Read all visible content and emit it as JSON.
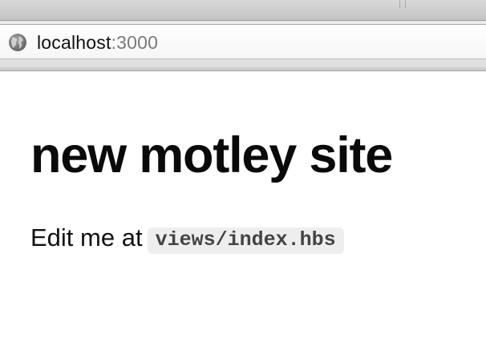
{
  "browser": {
    "url_host": "localhost",
    "url_port": ":3000",
    "address_icon": "globe-icon"
  },
  "page": {
    "title": "new motley site",
    "edit_prefix": "Edit me at",
    "edit_path": "views/index.hbs"
  },
  "colors": {
    "toolbar": "#c4c4c4",
    "url_port": "#7a7a7a",
    "code_bg": "#eeeeee",
    "code_text": "#444444",
    "heading": "#0a0a0a"
  }
}
